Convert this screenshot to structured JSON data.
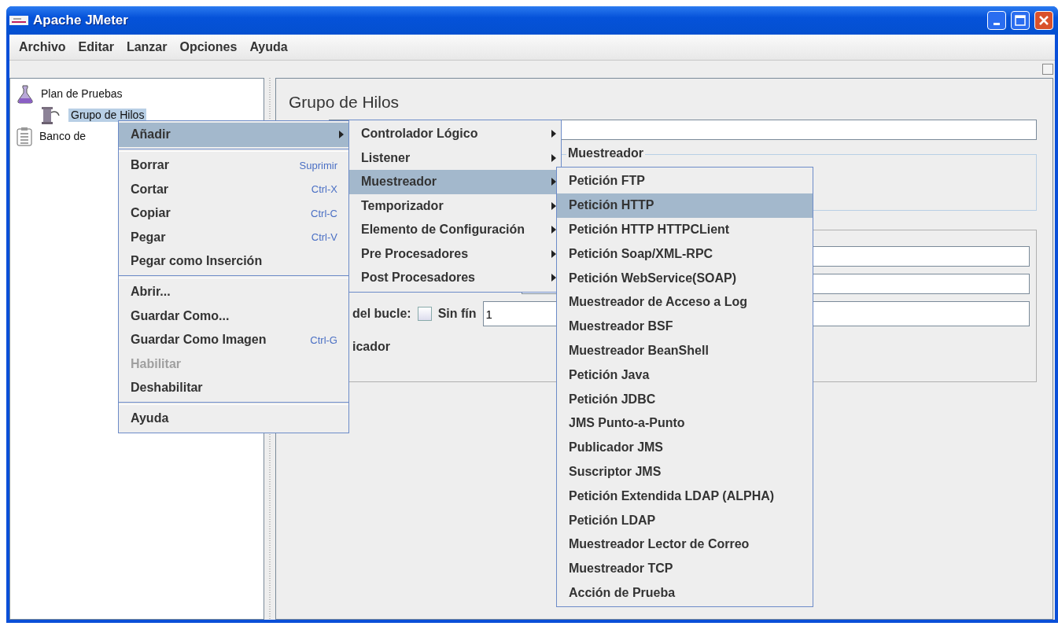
{
  "window": {
    "title": "Apache JMeter"
  },
  "menu_bar": [
    {
      "label": "Archivo"
    },
    {
      "label": "Editar"
    },
    {
      "label": "Lanzar"
    },
    {
      "label": "Opciones"
    },
    {
      "label": "Ayuda"
    }
  ],
  "tree": [
    {
      "label": "Plan de Pruebas",
      "selected": false,
      "children": [
        {
          "label": "Grupo de Hilos",
          "selected": true
        }
      ]
    },
    {
      "label": "Banco de",
      "selected": false
    }
  ],
  "panel": {
    "title": "Grupo de Hilos",
    "fieldset_legend": "Muestreador",
    "loop_label": "del bucle:",
    "forever_checkbox": {
      "label": "Sin fín",
      "checked": false
    },
    "loop_value": "1",
    "label_4": "icador"
  },
  "context_menu": [
    {
      "kind": "item",
      "label": "Añadir",
      "submenu": true,
      "selected": true,
      "disabled": false
    },
    {
      "kind": "separator"
    },
    {
      "kind": "item",
      "label": "Borrar",
      "shortcut": "Suprimir",
      "submenu": false,
      "selected": false,
      "disabled": false
    },
    {
      "kind": "item",
      "label": "Cortar",
      "shortcut": "Ctrl-X",
      "submenu": false,
      "selected": false,
      "disabled": false
    },
    {
      "kind": "item",
      "label": "Copiar",
      "shortcut": "Ctrl-C",
      "submenu": false,
      "selected": false,
      "disabled": false
    },
    {
      "kind": "item",
      "label": "Pegar",
      "shortcut": "Ctrl-V",
      "submenu": false,
      "selected": false,
      "disabled": false
    },
    {
      "kind": "item",
      "label": "Pegar como Inserción",
      "submenu": false,
      "selected": false,
      "disabled": false
    },
    {
      "kind": "separator"
    },
    {
      "kind": "item",
      "label": "Abrir...",
      "submenu": false,
      "selected": false,
      "disabled": false
    },
    {
      "kind": "item",
      "label": "Guardar Como...",
      "submenu": false,
      "selected": false,
      "disabled": false
    },
    {
      "kind": "item",
      "label": "Guardar Como Imagen",
      "shortcut": "Ctrl-G",
      "submenu": false,
      "selected": false,
      "disabled": false
    },
    {
      "kind": "item",
      "label": "Habilitar",
      "submenu": false,
      "selected": false,
      "disabled": true
    },
    {
      "kind": "item",
      "label": "Deshabilitar",
      "submenu": false,
      "selected": false,
      "disabled": false
    },
    {
      "kind": "separator"
    },
    {
      "kind": "item",
      "label": "Ayuda",
      "submenu": false,
      "selected": false,
      "disabled": false
    }
  ],
  "add_submenu": [
    {
      "label": "Controlador Lógico",
      "selected": false
    },
    {
      "label": "Listener",
      "selected": false
    },
    {
      "label": "Muestreador",
      "selected": true
    },
    {
      "label": "Temporizador",
      "selected": false
    },
    {
      "label": "Elemento de Configuración",
      "selected": false
    },
    {
      "label": "Pre Procesadores",
      "selected": false
    },
    {
      "label": "Post Procesadores",
      "selected": false
    }
  ],
  "sampler_submenu": [
    {
      "label": "Petición FTP",
      "selected": false
    },
    {
      "label": "Petición HTTP",
      "selected": true
    },
    {
      "label": "Petición HTTP HTTPCLient",
      "selected": false
    },
    {
      "label": "Petición Soap/XML-RPC",
      "selected": false
    },
    {
      "label": "Petición WebService(SOAP)",
      "selected": false
    },
    {
      "label": "Muestreador de Acceso a Log",
      "selected": false
    },
    {
      "label": "Muestreador BSF",
      "selected": false
    },
    {
      "label": "Muestreador BeanShell",
      "selected": false
    },
    {
      "label": "Petición Java",
      "selected": false
    },
    {
      "label": "Petición JDBC",
      "selected": false
    },
    {
      "label": "JMS Punto-a-Punto",
      "selected": false
    },
    {
      "label": "Publicador JMS",
      "selected": false
    },
    {
      "label": "Suscriptor JMS",
      "selected": false
    },
    {
      "label": "Petición Extendida LDAP (ALPHA)",
      "selected": false
    },
    {
      "label": "Petición LDAP",
      "selected": false
    },
    {
      "label": "Muestreador Lector de Correo",
      "selected": false
    },
    {
      "label": "Muestreador TCP",
      "selected": false
    },
    {
      "label": "Acción de Prueba",
      "selected": false
    }
  ]
}
